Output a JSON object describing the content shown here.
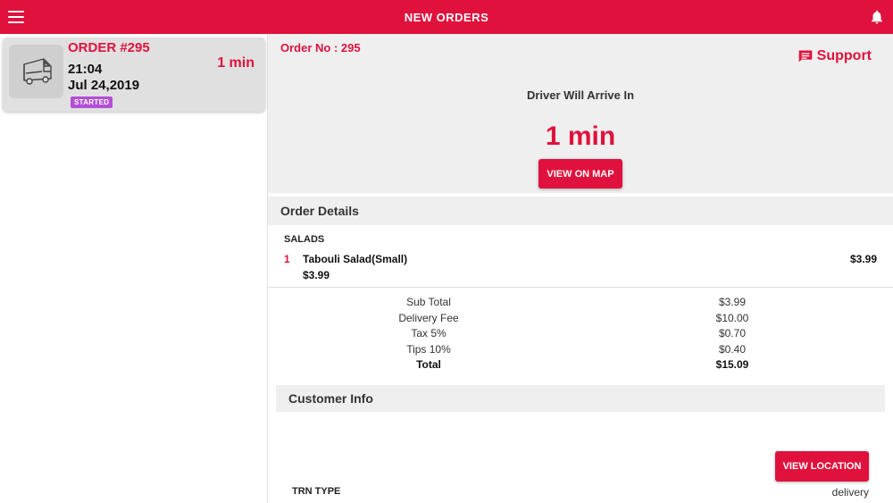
{
  "header": {
    "title": "NEW ORDERS",
    "menu_icon": "hamburger-menu-icon",
    "notification_icon": "bell-icon",
    "brand_color": "#e0113c"
  },
  "order_list": [
    {
      "order_label": "ORDER #295",
      "time": "21:04",
      "date": "Jul 24,2019",
      "status": "STARTED",
      "eta": "1 min",
      "icon": "delivery-truck-icon",
      "status_color": "#b24fd4"
    }
  ],
  "detail": {
    "order_no": "Order No : 295",
    "support_label": "Support",
    "support_icon": "chat-icon",
    "arrive_text": "Driver Will Arrive In",
    "eta": "1 min",
    "view_map_label": "VIEW ON MAP",
    "order_details_heading": "Order Details",
    "category": "SALADS",
    "items": [
      {
        "qty": "1",
        "name": "Tabouli Salad(Small)",
        "unit_price": "$3.99",
        "line_total": "$3.99"
      }
    ],
    "totals": [
      {
        "label": "Sub Total",
        "value": "$3.99"
      },
      {
        "label": "Delivery Fee",
        "value": "$10.00"
      },
      {
        "label": "Tax 5%",
        "value": "$0.70"
      },
      {
        "label": "Tips 10%",
        "value": "$0.40"
      },
      {
        "label": "Total",
        "value": "$15.09"
      }
    ],
    "customer_heading": "Customer Info",
    "view_location_label": "VIEW LOCATION",
    "trn_label": "TRN TYPE",
    "trn_value": "delivery"
  }
}
